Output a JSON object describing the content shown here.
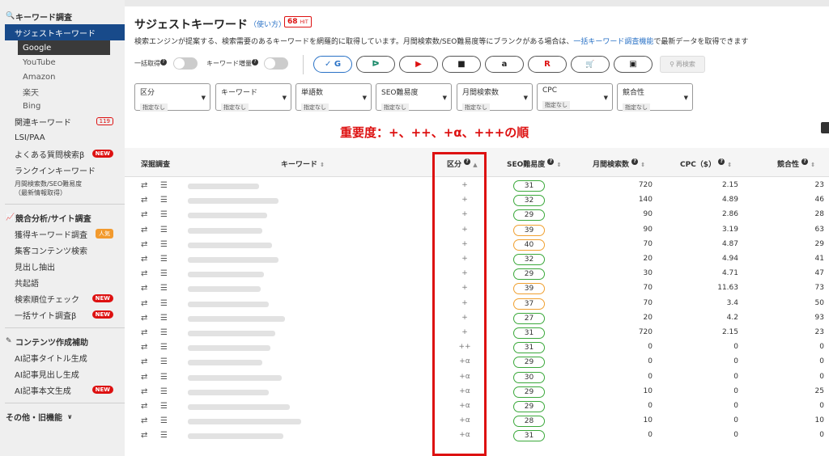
{
  "sidebar": {
    "sec1": "キーワード調査",
    "suggest": "サジェストキーワード",
    "subs": [
      "Google",
      "YouTube",
      "Amazon",
      "楽天",
      "Bing"
    ],
    "kanren": "関連キーワード",
    "kanren_badge": "119",
    "lsi": "LSI/PAA",
    "faq": "よくある質問検索β",
    "new": "NEW",
    "rankin": "ランクインキーワード",
    "monthly_1": "月間検索数/SEO難易度",
    "monthly_2": "（最新情報取得）",
    "sec2": "競合分析/サイト調査",
    "kakutoku": "獲得キーワード調査",
    "popular": "人気",
    "shukaku": "集客コンテンツ検索",
    "midashi": "見出し抽出",
    "kyoki": "共起語",
    "juni": "検索順位チェック",
    "ikkatsu": "一括サイト調査β",
    "sec3": "コンテンツ作成補助",
    "ai_title": "AI記事タイトル生成",
    "ai_midashi": "AI記事見出し生成",
    "ai_honbun": "AI記事本文生成",
    "sec4": "その他・旧機能",
    "icons": [
      "search-icon",
      "chart-icon",
      "edit-icon",
      "chevron-down-icon"
    ]
  },
  "main": {
    "title": "サジェストキーワード",
    "usage": "（使い方）",
    "hit_num": "68",
    "hit_unit": "HIT",
    "desc_pre": "検索エンジンが提案する、検索需要のあるキーワードを網羅的に取得しています。月間検索数/SEO難易度等にブランクがある場合は、",
    "desc_link": "一括キーワード調査機能",
    "desc_post": "で最新データを取得できます",
    "toggle_all": "一括取得",
    "toggle_add": "キーワード増量",
    "engines": [
      "✓ G",
      "ᐅ",
      "▶",
      "■",
      "a",
      "R",
      "🛒",
      "▣"
    ],
    "research": "再検索",
    "filters": [
      {
        "name": "区分",
        "value": "指定なし"
      },
      {
        "name": "キーワード",
        "value": "指定なし"
      },
      {
        "name": "単語数",
        "value": "指定なし"
      },
      {
        "name": "SEO難易度",
        "value": "指定なし"
      },
      {
        "name": "月間検索数",
        "value": "指定なし"
      },
      {
        "name": "CPC",
        "value": "指定なし"
      },
      {
        "name": "競合性",
        "value": "指定なし"
      }
    ],
    "note": "重要度：+、++、+α、+++の順"
  },
  "table": {
    "headers": [
      "深掘調査",
      "キーワード",
      "区分",
      "SEO難易度",
      "月間検索数",
      "CPC（$）",
      "競合性"
    ],
    "rows": [
      {
        "kubun": "+",
        "seo": "31",
        "vol": "720",
        "cpc": "2.15",
        "comp": "23"
      },
      {
        "kubun": "+",
        "seo": "32",
        "vol": "140",
        "cpc": "4.89",
        "comp": "46"
      },
      {
        "kubun": "+",
        "seo": "29",
        "vol": "90",
        "cpc": "2.86",
        "comp": "28"
      },
      {
        "kubun": "+",
        "seo": "39",
        "vol": "90",
        "cpc": "3.19",
        "comp": "63"
      },
      {
        "kubun": "+",
        "seo": "40",
        "vol": "70",
        "cpc": "4.87",
        "comp": "29"
      },
      {
        "kubun": "+",
        "seo": "32",
        "vol": "20",
        "cpc": "4.94",
        "comp": "41"
      },
      {
        "kubun": "+",
        "seo": "29",
        "vol": "30",
        "cpc": "4.71",
        "comp": "47"
      },
      {
        "kubun": "+",
        "seo": "39",
        "vol": "70",
        "cpc": "11.63",
        "comp": "73"
      },
      {
        "kubun": "+",
        "seo": "37",
        "vol": "70",
        "cpc": "3.4",
        "comp": "50"
      },
      {
        "kubun": "+",
        "seo": "27",
        "vol": "20",
        "cpc": "4.2",
        "comp": "93"
      },
      {
        "kubun": "+",
        "seo": "31",
        "vol": "720",
        "cpc": "2.15",
        "comp": "23"
      },
      {
        "kubun": "++",
        "seo": "31",
        "vol": "0",
        "cpc": "0",
        "comp": "0"
      },
      {
        "kubun": "+α",
        "seo": "29",
        "vol": "0",
        "cpc": "0",
        "comp": "0"
      },
      {
        "kubun": "+α",
        "seo": "30",
        "vol": "0",
        "cpc": "0",
        "comp": "0"
      },
      {
        "kubun": "+α",
        "seo": "29",
        "vol": "10",
        "cpc": "0",
        "comp": "25"
      },
      {
        "kubun": "+α",
        "seo": "29",
        "vol": "0",
        "cpc": "0",
        "comp": "0"
      },
      {
        "kubun": "+α",
        "seo": "28",
        "vol": "10",
        "cpc": "0",
        "comp": "10"
      },
      {
        "kubun": "+α",
        "seo": "31",
        "vol": "0",
        "cpc": "0",
        "comp": "0"
      }
    ]
  },
  "colors": {
    "accent": "#184a8a",
    "red": "#d11",
    "pill_green": "#3aa83a",
    "pill_orange": "#f0a030",
    "link": "#2a72c6"
  }
}
